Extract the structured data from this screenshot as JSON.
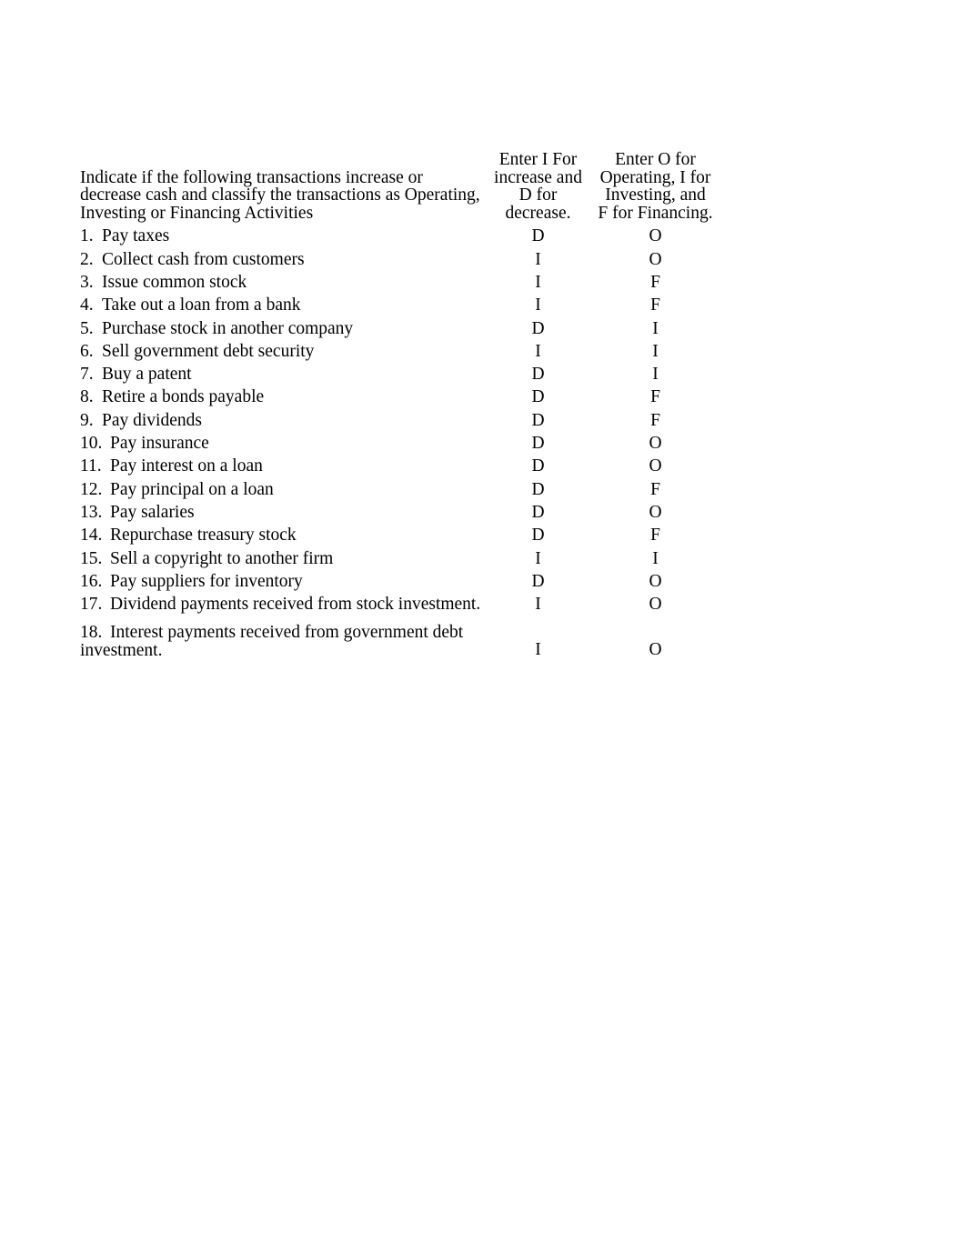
{
  "header": {
    "prompt_lines": [
      "Indicate if the following transactions increase or",
      "decrease cash and classify the transactions as Operating,",
      "Investing or Financing Activities"
    ],
    "column_a_lines": [
      "Enter I For",
      "increase and",
      "D for",
      "decrease."
    ],
    "column_b_lines": [
      "Enter O for",
      "Operating, I for",
      "Investing, and",
      "F for Financing."
    ]
  },
  "items": [
    {
      "num": "1.",
      "text": "Pay taxes",
      "cash": "D",
      "activity": "O",
      "wrap": false
    },
    {
      "num": "2.",
      "text": "Collect cash from customers",
      "cash": "I",
      "activity": "O",
      "wrap": false
    },
    {
      "num": "3.",
      "text": "Issue common stock",
      "cash": "I",
      "activity": "F",
      "wrap": false
    },
    {
      "num": "4.",
      "text": "Take out a loan from a bank",
      "cash": "I",
      "activity": "F",
      "wrap": false
    },
    {
      "num": "5.",
      "text": "Purchase stock in another company",
      "cash": "D",
      "activity": "I",
      "wrap": false
    },
    {
      "num": "6.",
      "text": "Sell government debt security",
      "cash": "I",
      "activity": "I",
      "wrap": false
    },
    {
      "num": "7.",
      "text": "Buy a patent",
      "cash": "D",
      "activity": "I",
      "wrap": false
    },
    {
      "num": "8.",
      "text": "Retire a bonds payable",
      "cash": "D",
      "activity": "F",
      "wrap": false
    },
    {
      "num": "9.",
      "text": "Pay dividends",
      "cash": "D",
      "activity": "F",
      "wrap": false
    },
    {
      "num": "10.",
      "text": "Pay insurance",
      "cash": "D",
      "activity": "O",
      "wrap": false
    },
    {
      "num": "11.",
      "text": "Pay interest on a loan",
      "cash": "D",
      "activity": "O",
      "wrap": false
    },
    {
      "num": "12.",
      "text": "Pay principal on a loan",
      "cash": "D",
      "activity": "F",
      "wrap": false
    },
    {
      "num": "13.",
      "text": "Pay salaries",
      "cash": "D",
      "activity": "O",
      "wrap": false
    },
    {
      "num": "14.",
      "text": "Repurchase treasury stock",
      "cash": "D",
      "activity": "F",
      "wrap": false
    },
    {
      "num": "15.",
      "text": "Sell a copyright to another firm",
      "cash": "I",
      "activity": "I",
      "wrap": false
    },
    {
      "num": "16.",
      "text": "Pay suppliers for inventory",
      "cash": "D",
      "activity": "O",
      "wrap": false
    },
    {
      "num": "17.",
      "text": "Dividend payments received from stock investment.",
      "cash": "I",
      "activity": "O",
      "wrap": false
    },
    {
      "num": "18.",
      "text": "Interest payments received from government debt investment.",
      "cash": "I",
      "activity": "O",
      "wrap": true,
      "line1": "Interest payments received from government debt",
      "line2": "investment."
    }
  ]
}
